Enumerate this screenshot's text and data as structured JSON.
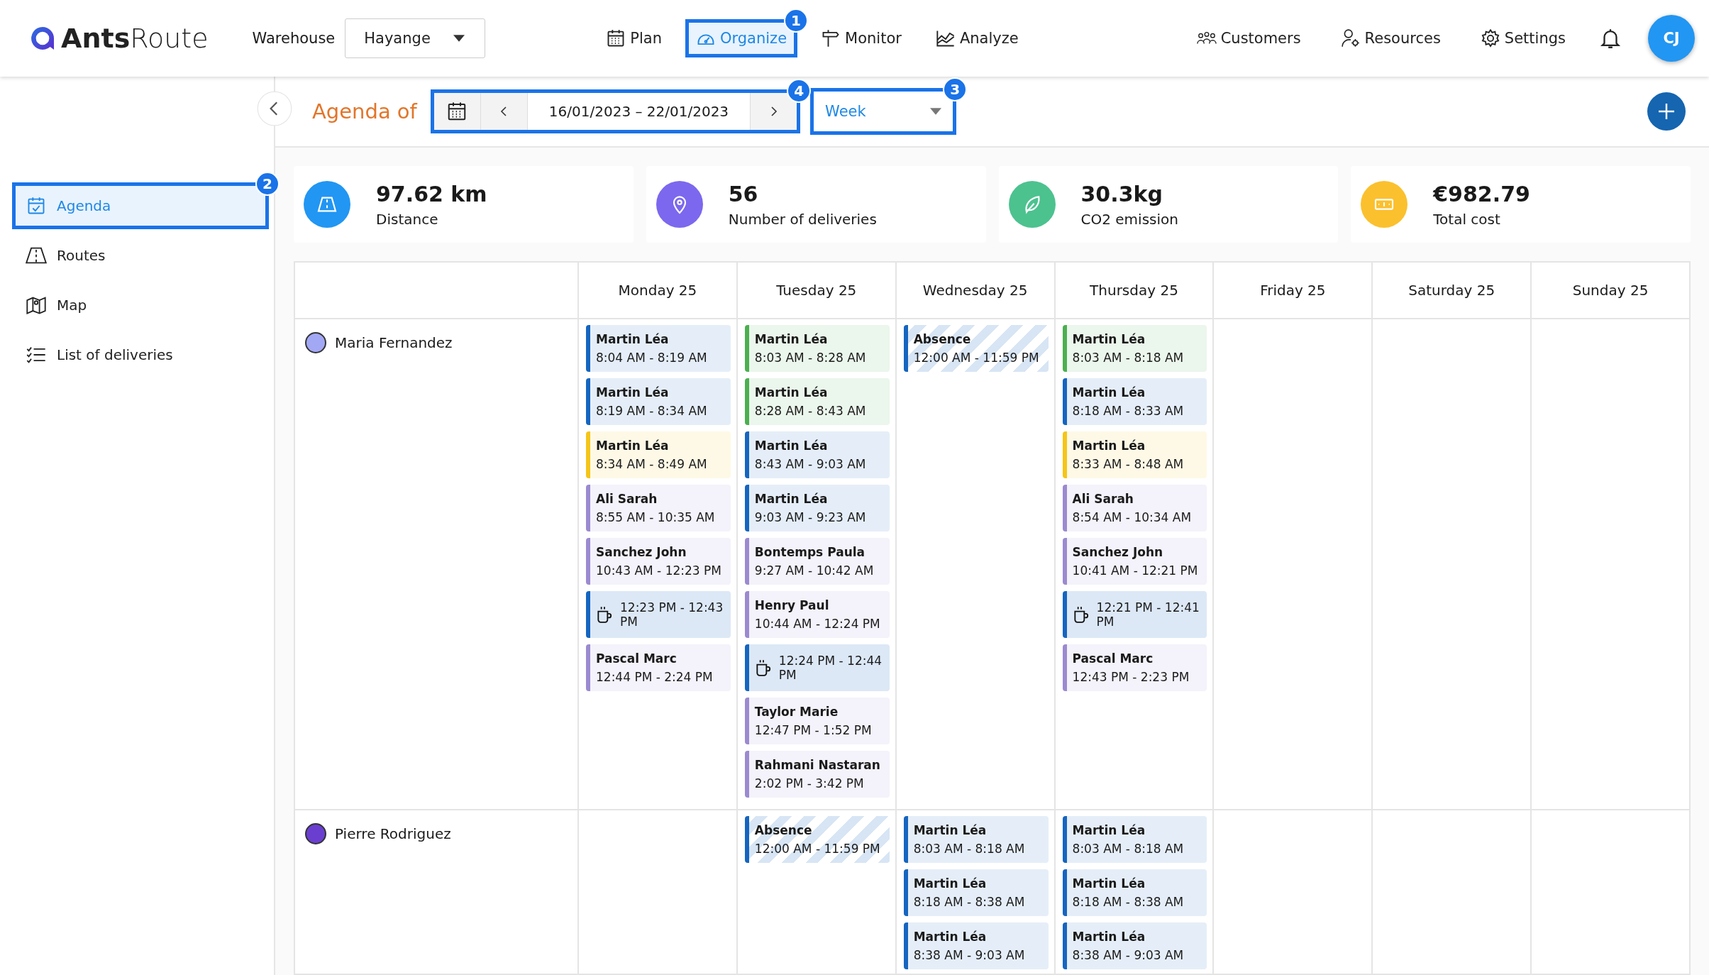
{
  "brand": {
    "name_bold": "Ants",
    "name_light": "Route"
  },
  "warehouse": {
    "label": "Warehouse",
    "value": "Hayange"
  },
  "nav": [
    {
      "label": "Plan",
      "selected": false
    },
    {
      "label": "Organize",
      "selected": true,
      "callout": "1"
    },
    {
      "label": "Monitor",
      "selected": false
    },
    {
      "label": "Analyze",
      "selected": false
    }
  ],
  "nav_right": [
    {
      "label": "Customers"
    },
    {
      "label": "Resources"
    },
    {
      "label": "Settings"
    }
  ],
  "avatar": "CJ",
  "sidebar": {
    "items": [
      {
        "label": "Agenda",
        "selected": true,
        "callout": "2"
      },
      {
        "label": "Routes",
        "selected": false
      },
      {
        "label": "Map",
        "selected": false
      },
      {
        "label": "List of deliveries",
        "selected": false
      }
    ]
  },
  "toolbar": {
    "title": "Agenda of",
    "date_range": "16/01/2023 – 22/01/2023",
    "date_callout": "4",
    "view": "Week",
    "view_callout": "3"
  },
  "kpis": [
    {
      "value": "97.62 km",
      "label": "Distance",
      "color": "#2196f3"
    },
    {
      "value": "56",
      "label": "Number of deliveries",
      "color": "#7b68ee"
    },
    {
      "value": "30.3kg",
      "label": "CO2 emission",
      "color": "#4cc28f"
    },
    {
      "value": "€982.79",
      "label": "Total cost",
      "color": "#fbc02d"
    }
  ],
  "calendar": {
    "days": [
      "Monday 25",
      "Tuesday 25",
      "Wednesday 25",
      "Thursday 25",
      "Friday 25",
      "Saturday 25",
      "Sunday 25"
    ],
    "resources": [
      {
        "name": "Maria Fernandez",
        "color": "#a3a8f5",
        "days": {
          "monday": [
            {
              "kind": "delivery",
              "name": "Martin Léa",
              "time": "8:04 AM - 8:19 AM",
              "color": "#1565c0"
            },
            {
              "kind": "delivery",
              "name": "Martin Léa",
              "time": "8:19 AM - 8:34 AM",
              "color": "#1565c0"
            },
            {
              "kind": "delivery",
              "name": "Martin Léa",
              "time": "8:34 AM - 8:49 AM",
              "color": "#f5c518"
            },
            {
              "kind": "delivery",
              "name": "Ali Sarah",
              "time": "8:55 AM - 10:35 AM",
              "color": "#9b8ad0"
            },
            {
              "kind": "delivery",
              "name": "Sanchez John",
              "time": "10:43 AM - 12:23 PM",
              "color": "#9b8ad0"
            },
            {
              "kind": "break",
              "time": "12:23 PM - 12:43 PM",
              "color": "#1565c0"
            },
            {
              "kind": "delivery",
              "name": "Pascal Marc",
              "time": "12:44 PM - 2:24 PM",
              "color": "#9b8ad0"
            }
          ],
          "tuesday": [
            {
              "kind": "delivery",
              "name": "Martin Léa",
              "time": "8:03 AM - 8:28 AM",
              "color": "#4caf50"
            },
            {
              "kind": "delivery",
              "name": "Martin Léa",
              "time": "8:28 AM - 8:43 AM",
              "color": "#4caf50"
            },
            {
              "kind": "delivery",
              "name": "Martin Léa",
              "time": "8:43 AM - 9:03 AM",
              "color": "#1565c0"
            },
            {
              "kind": "delivery",
              "name": "Martin Léa",
              "time": "9:03 AM - 9:23 AM",
              "color": "#1565c0"
            },
            {
              "kind": "delivery",
              "name": "Bontemps Paula",
              "time": "9:27 AM - 10:42 AM",
              "color": "#9b8ad0"
            },
            {
              "kind": "delivery",
              "name": "Henry Paul",
              "time": "10:44 AM - 12:24 PM",
              "color": "#9b8ad0"
            },
            {
              "kind": "break",
              "time": "12:24 PM - 12:44 PM",
              "color": "#1565c0"
            },
            {
              "kind": "delivery",
              "name": "Taylor Marie",
              "time": "12:47 PM - 1:52 PM",
              "color": "#9b8ad0"
            },
            {
              "kind": "delivery",
              "name": "Rahmani Nastaran",
              "time": "2:02 PM - 3:42 PM",
              "color": "#9b8ad0"
            }
          ],
          "wednesday": [
            {
              "kind": "absence",
              "name": "Absence",
              "time": "12:00 AM - 11:59 PM",
              "color": "#1565c0"
            }
          ],
          "thursday": [
            {
              "kind": "delivery",
              "name": "Martin Léa",
              "time": "8:03 AM - 8:18 AM",
              "color": "#4caf50"
            },
            {
              "kind": "delivery",
              "name": "Martin Léa",
              "time": "8:18 AM - 8:33 AM",
              "color": "#1565c0"
            },
            {
              "kind": "delivery",
              "name": "Martin Léa",
              "time": "8:33 AM - 8:48 AM",
              "color": "#f5c518"
            },
            {
              "kind": "delivery",
              "name": "Ali Sarah",
              "time": "8:54 AM - 10:34 AM",
              "color": "#9b8ad0"
            },
            {
              "kind": "delivery",
              "name": "Sanchez John",
              "time": "10:41 AM - 12:21 PM",
              "color": "#9b8ad0"
            },
            {
              "kind": "break",
              "time": "12:21 PM - 12:41 PM",
              "color": "#1565c0"
            },
            {
              "kind": "delivery",
              "name": "Pascal Marc",
              "time": "12:43 PM - 2:23 PM",
              "color": "#9b8ad0"
            }
          ]
        }
      },
      {
        "name": "Pierre Rodriguez",
        "color": "#6a3fd0",
        "days": {
          "tuesday": [
            {
              "kind": "absence",
              "name": "Absence",
              "time": "12:00 AM - 11:59 PM",
              "color": "#1565c0"
            }
          ],
          "wednesday": [
            {
              "kind": "delivery",
              "name": "Martin Léa",
              "time": "8:03 AM - 8:18 AM",
              "color": "#1565c0"
            },
            {
              "kind": "delivery",
              "name": "Martin Léa",
              "time": "8:18 AM - 8:38 AM",
              "color": "#1565c0"
            },
            {
              "kind": "delivery",
              "name": "Martin Léa",
              "time": "8:38 AM - 9:03 AM",
              "color": "#1565c0"
            }
          ],
          "thursday": [
            {
              "kind": "delivery",
              "name": "Martin Léa",
              "time": "8:03 AM - 8:18 AM",
              "color": "#1565c0"
            },
            {
              "kind": "delivery",
              "name": "Martin Léa",
              "time": "8:18 AM - 8:38 AM",
              "color": "#1565c0"
            },
            {
              "kind": "delivery",
              "name": "Martin Léa",
              "time": "8:38 AM - 9:03 AM",
              "color": "#1565c0"
            }
          ]
        }
      }
    ]
  }
}
